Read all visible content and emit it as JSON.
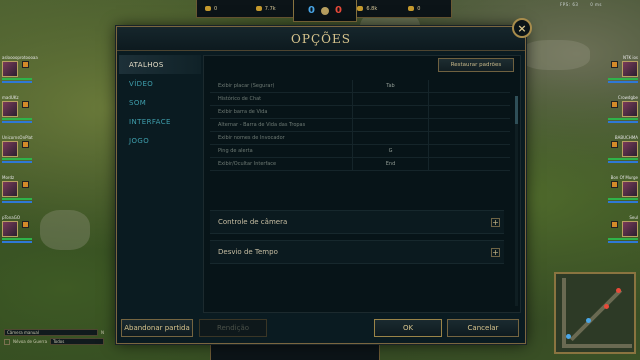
{
  "hud": {
    "blue_gold": "0",
    "blue_stat": "7.7k",
    "score_blue": "0",
    "score_red": "0",
    "red_gold": "6.8k",
    "red_stat": "0",
    "fps": "FPS: 63",
    "ms": "0 ms"
  },
  "left_team": [
    {
      "name": "aslooooprotoooaa"
    },
    {
      "name": "madUKz"
    },
    {
      "name": "UnicornsOnPlat"
    },
    {
      "name": "Mordz"
    },
    {
      "name": "pTonaGO"
    }
  ],
  "right_team": [
    {
      "name": "NTK ios"
    },
    {
      "name": "Crowdgbe"
    },
    {
      "name": "BABUCHMA"
    },
    {
      "name": "Bon Of Murge"
    },
    {
      "name": "Seul"
    }
  ],
  "chat": {
    "channel_label": "Câmera manual",
    "hotkey": "N",
    "option_label": "Névoa de Guerra",
    "option_value": "Todos"
  },
  "dialog": {
    "title": "OPÇÕES",
    "close_icon": "×",
    "nav": [
      {
        "label": "ATALHOS",
        "active": true
      },
      {
        "label": "VÍDEO",
        "active": false
      },
      {
        "label": "SOM",
        "active": false
      },
      {
        "label": "INTERFACE",
        "active": false
      },
      {
        "label": "JOGO",
        "active": false
      }
    ],
    "restore_label": "Restaurar padrões",
    "keybinds": [
      {
        "action": "Exibir placar (Segurar)",
        "key": "Tab"
      },
      {
        "action": "Histórico de Chat",
        "key": ""
      },
      {
        "action": "Exibir barra de Vida",
        "key": ""
      },
      {
        "action": "Alternar - Barra de Vida das Tropas",
        "key": ""
      },
      {
        "action": "Exibir nomes de Invocador",
        "key": ""
      },
      {
        "action": "Ping de alerta",
        "key": "G"
      },
      {
        "action": "Exibir/Ocultar Interface",
        "key": "End"
      }
    ],
    "sections": [
      {
        "label": "Controle de câmera",
        "icon": "+"
      },
      {
        "label": "Desvio de Tempo",
        "icon": "+"
      }
    ],
    "buttons": {
      "abandon": "Abandonar partida",
      "surrender": "Rendição",
      "ok": "OK",
      "cancel": "Cancelar"
    }
  },
  "colors": {
    "accent_gold": "#c8b98a",
    "nav_teal": "#3f9fad",
    "blue_team": "#4aa7e8",
    "red_team": "#e84a3a"
  }
}
